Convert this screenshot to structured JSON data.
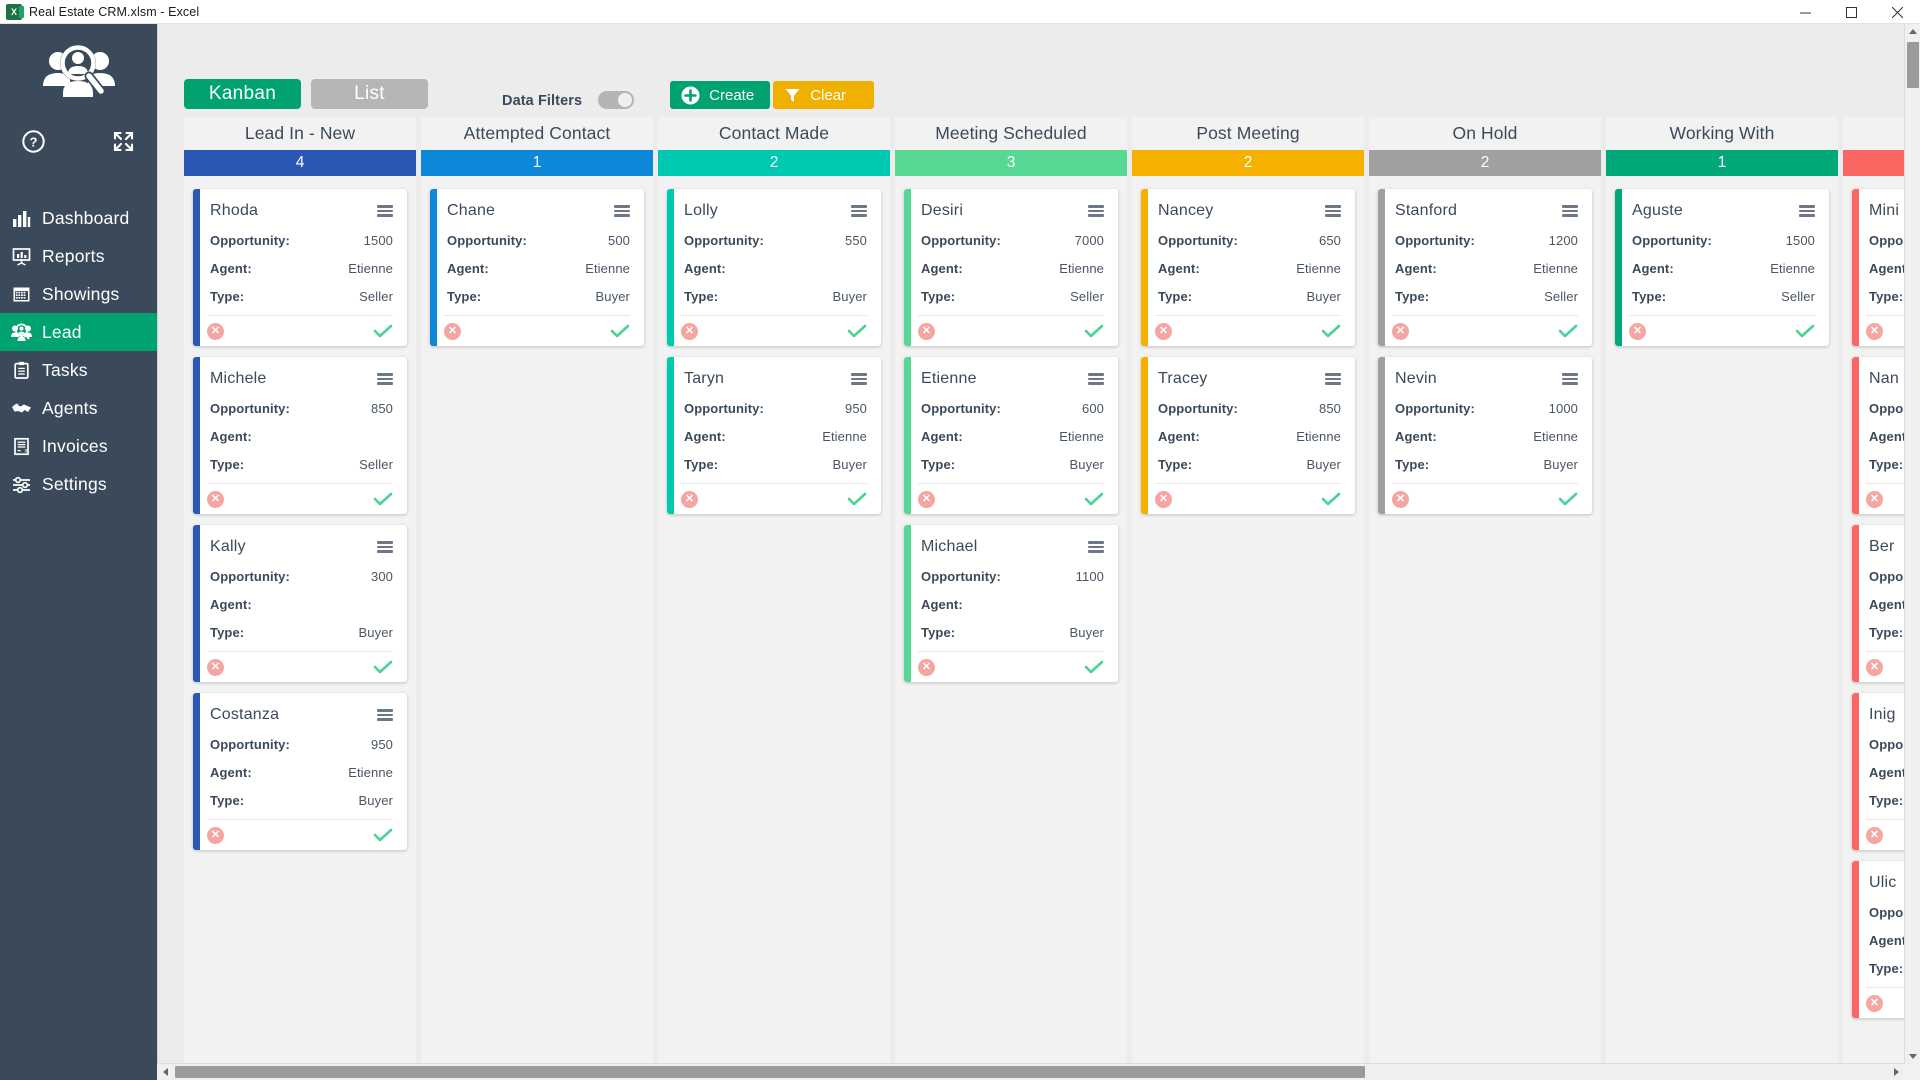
{
  "window": {
    "title": "Real Estate CRM.xlsm - Excel",
    "app_icon": "excel-icon",
    "minimize": "–",
    "maximize": "❑",
    "close": "✕"
  },
  "sidebar": {
    "logo": "lead-search-logo",
    "help_icon": "help-circle-icon",
    "expand_icon": "expand-fullscreen-icon",
    "active_item": "Lead",
    "items": [
      {
        "label": "Dashboard",
        "icon": "bar-chart-icon"
      },
      {
        "label": "Reports",
        "icon": "presentation-chart-icon"
      },
      {
        "label": "Showings",
        "icon": "calendar-grid-icon"
      },
      {
        "label": "Lead",
        "icon": "lead-search-icon"
      },
      {
        "label": "Tasks",
        "icon": "clipboard-icon"
      },
      {
        "label": "Agents",
        "icon": "handshake-icon"
      },
      {
        "label": "Invoices",
        "icon": "invoice-icon"
      },
      {
        "label": "Settings",
        "icon": "sliders-icon"
      }
    ]
  },
  "toolbar": {
    "kanban_label": "Kanban",
    "list_label": "List",
    "filters_label": "Data Filters",
    "filters_toggle_state": "off",
    "create_label": "Create",
    "create_icon": "plus-circle-icon",
    "clear_label": "Clear",
    "clear_icon": "funnel-icon"
  },
  "card_labels": {
    "opportunity": "Opportunity:",
    "agent": "Agent:",
    "type": "Type:",
    "menu_icon": "hamburger-menu-icon",
    "delete_icon": "delete-circle-icon",
    "confirm_icon": "check-icon"
  },
  "colors": {
    "lead_in_new": "#2b57b5",
    "attempted_contact": "#0d87d8",
    "contact_made": "#00c9b1",
    "meeting_scheduled": "#57d995",
    "post_meeting": "#f5b000",
    "on_hold": "#a0a0a0",
    "working_with": "#00a87a",
    "next_column": "#fa6661",
    "sidebar": "#3b4a5a",
    "accent_green": "#00a36f",
    "clear_amber": "#f0b000"
  },
  "board": {
    "columns": [
      {
        "title": "Lead In - New",
        "count": "4",
        "color": "#2b57b5",
        "cards": [
          {
            "name": "Rhoda",
            "opportunity": "1500",
            "agent": "Etienne",
            "type": "Seller"
          },
          {
            "name": "Michele",
            "opportunity": "850",
            "agent": "",
            "type": "Seller"
          },
          {
            "name": "Kally",
            "opportunity": "300",
            "agent": "",
            "type": "Buyer"
          },
          {
            "name": "Costanza",
            "opportunity": "950",
            "agent": "Etienne",
            "type": "Buyer"
          }
        ]
      },
      {
        "title": "Attempted Contact",
        "count": "1",
        "color": "#0d87d8",
        "cards": [
          {
            "name": "Chane",
            "opportunity": "500",
            "agent": "Etienne",
            "type": "Buyer"
          }
        ]
      },
      {
        "title": "Contact Made",
        "count": "2",
        "color": "#00c9b1",
        "cards": [
          {
            "name": "Lolly",
            "opportunity": "550",
            "agent": "",
            "type": "Buyer"
          },
          {
            "name": "Taryn",
            "opportunity": "950",
            "agent": "Etienne",
            "type": "Buyer"
          }
        ]
      },
      {
        "title": "Meeting Scheduled",
        "count": "3",
        "color": "#57d995",
        "cards": [
          {
            "name": "Desiri",
            "opportunity": "7000",
            "agent": "Etienne",
            "type": "Seller"
          },
          {
            "name": "Etienne",
            "opportunity": "600",
            "agent": "Etienne",
            "type": "Buyer"
          },
          {
            "name": "Michael",
            "opportunity": "1100",
            "agent": "",
            "type": "Buyer"
          }
        ]
      },
      {
        "title": "Post Meeting",
        "count": "2",
        "color": "#f5b000",
        "cards": [
          {
            "name": "Nancey",
            "opportunity": "650",
            "agent": "Etienne",
            "type": "Buyer"
          },
          {
            "name": "Tracey",
            "opportunity": "850",
            "agent": "Etienne",
            "type": "Buyer"
          }
        ]
      },
      {
        "title": "On Hold",
        "count": "2",
        "color": "#a0a0a0",
        "cards": [
          {
            "name": "Stanford",
            "opportunity": "1200",
            "agent": "Etienne",
            "type": "Seller"
          },
          {
            "name": "Nevin",
            "opportunity": "1000",
            "agent": "Etienne",
            "type": "Buyer"
          }
        ]
      },
      {
        "title": "Working With",
        "count": "1",
        "color": "#00a87a",
        "cards": [
          {
            "name": "Aguste",
            "opportunity": "1500",
            "agent": "Etienne",
            "type": "Seller"
          }
        ]
      },
      {
        "title": "",
        "count": "",
        "color": "#fa6661",
        "clipped": true,
        "cards": [
          {
            "name": "Mini",
            "opportunity": "",
            "agent": "",
            "type": ""
          },
          {
            "name": "Nan",
            "opportunity": "",
            "agent": "",
            "type": ""
          },
          {
            "name": "Ber",
            "opportunity": "",
            "agent": "",
            "type": ""
          },
          {
            "name": "Inig",
            "opportunity": "",
            "agent": "",
            "type": ""
          },
          {
            "name": "Ulic",
            "opportunity": "",
            "agent": "",
            "type": ""
          }
        ]
      }
    ]
  }
}
